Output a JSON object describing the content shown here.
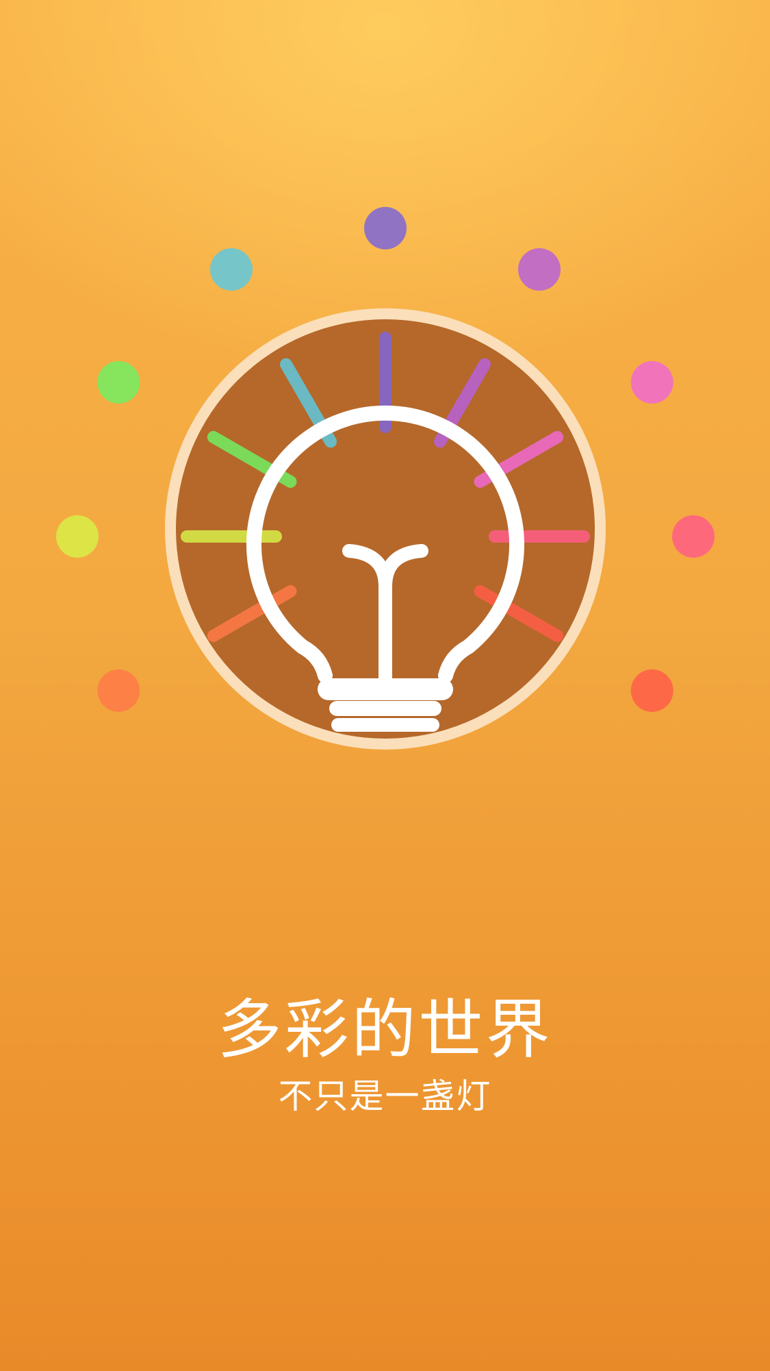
{
  "splash": {
    "title": "多彩的世界",
    "subtitle": "不只是一盏灯"
  },
  "illustration": {
    "icon": "lightbulb-icon",
    "disc_color": "#b5682a",
    "ring_color": "#fbdfba",
    "bulb_color": "#ffffff",
    "rays": [
      {
        "name": "purple",
        "color": "#7e66d8",
        "angle": 0
      },
      {
        "name": "magenta",
        "color": "#b761d8",
        "angle": 30
      },
      {
        "name": "pink",
        "color": "#f06ad0",
        "angle": 60
      },
      {
        "name": "rose",
        "color": "#ff5d86",
        "angle": 90
      },
      {
        "name": "red-orange",
        "color": "#ff5e48",
        "angle": 120
      },
      {
        "name": "orange",
        "color": "#ff7a48",
        "angle": 240
      },
      {
        "name": "yellow",
        "color": "#d8ee48",
        "angle": 270
      },
      {
        "name": "green",
        "color": "#72ee62",
        "angle": 300
      },
      {
        "name": "teal",
        "color": "#5fc8de",
        "angle": 330
      }
    ]
  }
}
